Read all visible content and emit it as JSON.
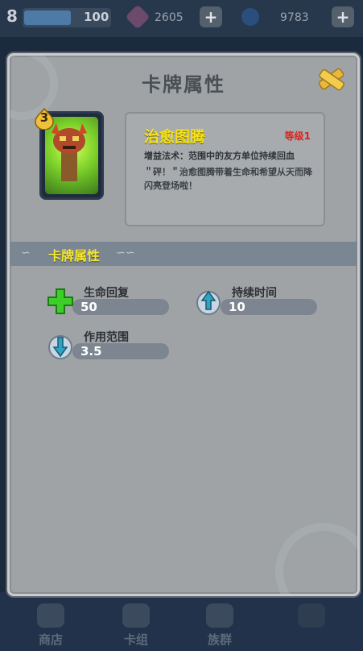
{
  "topbar": {
    "level": "8",
    "xp_progress": 0.55,
    "xp_value": "100",
    "gems": "2605",
    "crystals": "9783",
    "gem_color": "#8a4a8a",
    "crystal_color": "#2f6fbf"
  },
  "modal": {
    "title": "卡牌属性",
    "card": {
      "cost": "3",
      "name": "治愈图腾",
      "level": "等级1",
      "type_line": "增益法术：范围中的友方单位持续回血",
      "description": "＂砰！＂治愈图腾带着生命和希望从天而降闪亮登场啦！"
    },
    "section_title": "卡牌属性",
    "stats": [
      {
        "label": "生命回复",
        "value": "50",
        "icon": "green-plus-icon"
      },
      {
        "label": "持续时间",
        "value": "10",
        "icon": "duration-arrow-icon"
      },
      {
        "label": "作用范围",
        "value": "3.5",
        "icon": "range-arrow-icon"
      }
    ]
  },
  "nav": {
    "items": [
      {
        "label": "商店",
        "icon": "shop-icon"
      },
      {
        "label": "卡组",
        "icon": "deck-icon"
      },
      {
        "label": "族群",
        "icon": "clan-icon"
      },
      {
        "label": "",
        "icon": "battle-icon"
      }
    ]
  },
  "colors": {
    "panel_bg": "#9fa3a6",
    "accent_yellow": "#f4e634",
    "level_red": "#d8241f",
    "stat_bar": "#7c8590"
  }
}
